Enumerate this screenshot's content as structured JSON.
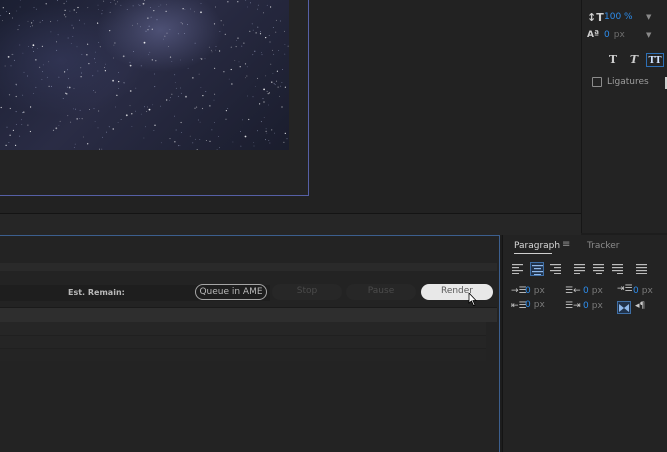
{
  "character_panel": {
    "scale_value": "100 %",
    "baseline_value": "0",
    "baseline_unit": "px",
    "style_buttons": [
      "T",
      "T",
      "TT"
    ],
    "ligatures_label": "Ligatures"
  },
  "render_queue": {
    "est_remain_label": "Est. Remain:",
    "queue_in_ame_label": "Queue in AME",
    "stop_label": "Stop",
    "pause_label": "Pause",
    "render_label": "Render"
  },
  "paragraph_panel": {
    "tabs": [
      "Paragraph",
      "Tracker"
    ],
    "indent_left": "0",
    "indent_right": "0",
    "indent_first": "0",
    "space_before": "0",
    "space_after": "0",
    "unit": "px"
  },
  "colors": {
    "accent_blue": "#2d8ceb",
    "panel_bg": "#232323",
    "frame_border": "#5660a6"
  }
}
